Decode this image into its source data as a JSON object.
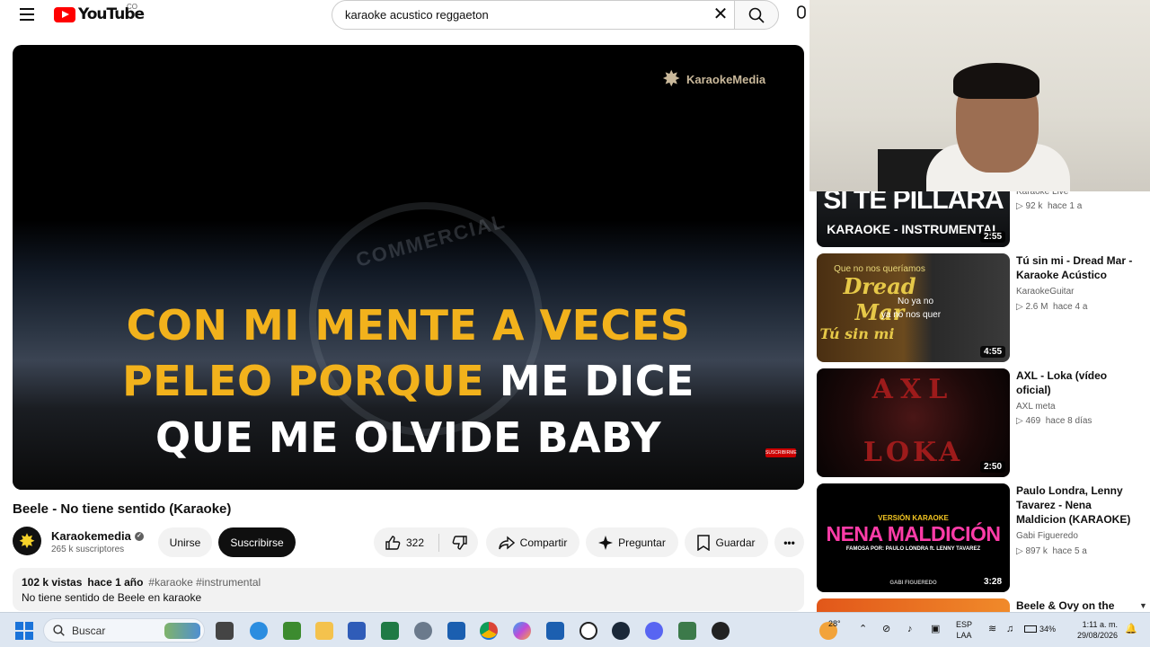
{
  "header": {
    "logo_text": "YouTube",
    "country": "CO",
    "search_value": "karaoke acustico reggaeton"
  },
  "player": {
    "brand": "KaraokeMedia",
    "lyrics": {
      "line1": "CON MI MENTE A VECES",
      "line2_highlight": "PELEO PORQUE",
      "line2_rest": " ME DICE",
      "line3": "QUE ME OLVIDE BABY"
    },
    "watermark": "COMMERCIAL",
    "sub_badge": "SUSCRIBIRME"
  },
  "video": {
    "title": "Beele - No tiene sentido (Karaoke)",
    "channel": "Karaokemedia",
    "subscribers": "265 k suscriptores",
    "join_label": "Unirse",
    "subscribe_label": "Suscribirse",
    "likes": "322",
    "share_label": "Compartir",
    "ask_label": "Preguntar",
    "save_label": "Guardar",
    "views": "102 k vistas",
    "age": "hace 1 año",
    "tags": "#karaoke #instrumental",
    "description": "No tiene sentido de Beele en karaoke"
  },
  "sidebar": {
    "items": [
      {
        "title": "",
        "channel": "Karaoke Live",
        "views": "92 k",
        "age": "hace 1 a",
        "duration": "2:55",
        "thumb_line1": "SI TE PILLARA",
        "thumb_line2": "KARAOKE - INSTRUMENTAL"
      },
      {
        "title": "Tú sin mi - Dread Mar - Karaoke Acústico",
        "channel": "KaraokeGuitar",
        "views": "2.6 M",
        "age": "hace 4 a",
        "duration": "4:55",
        "thumb_line1": "Dread Mar",
        "thumb_line2": "Tú sin mi",
        "thumb_small1": "Que no nos queríamos",
        "thumb_small2": "No ya no",
        "thumb_small3": "ya no nos quer"
      },
      {
        "title": "AXL - Loka (vídeo oficial)",
        "channel": "AXL meta",
        "views": "469",
        "age": "hace 8 días",
        "duration": "2:50",
        "thumb_line1": "AXL",
        "thumb_line2": "LOKA"
      },
      {
        "title": "Paulo Londra, Lenny Tavarez - Nena Maldicion (KARAOKE)",
        "channel": "Gabi Figueredo",
        "views": "897 k",
        "age": "hace 5 a",
        "duration": "3:28",
        "thumb_top": "VERSIÓN KARAOKE",
        "thumb_line1": "NENA MALDICIÓN",
        "thumb_line2": "FAMOSA POR: PAULO LONDRA ft. LENNY TAVAREZ",
        "thumb_bottom": "GABI FIGUEREDO"
      },
      {
        "title": "Beele & Ovy on the"
      }
    ]
  },
  "taskbar": {
    "search_placeholder": "Buscar",
    "weather": "28°",
    "lang1": "ESP",
    "lang2": "LAA",
    "battery": "34%",
    "time": "1:11 a. m.",
    "date": "29/08/2026"
  },
  "colors": {
    "lyric_yellow": "#f2b21c",
    "yt_red": "#ff0000"
  }
}
